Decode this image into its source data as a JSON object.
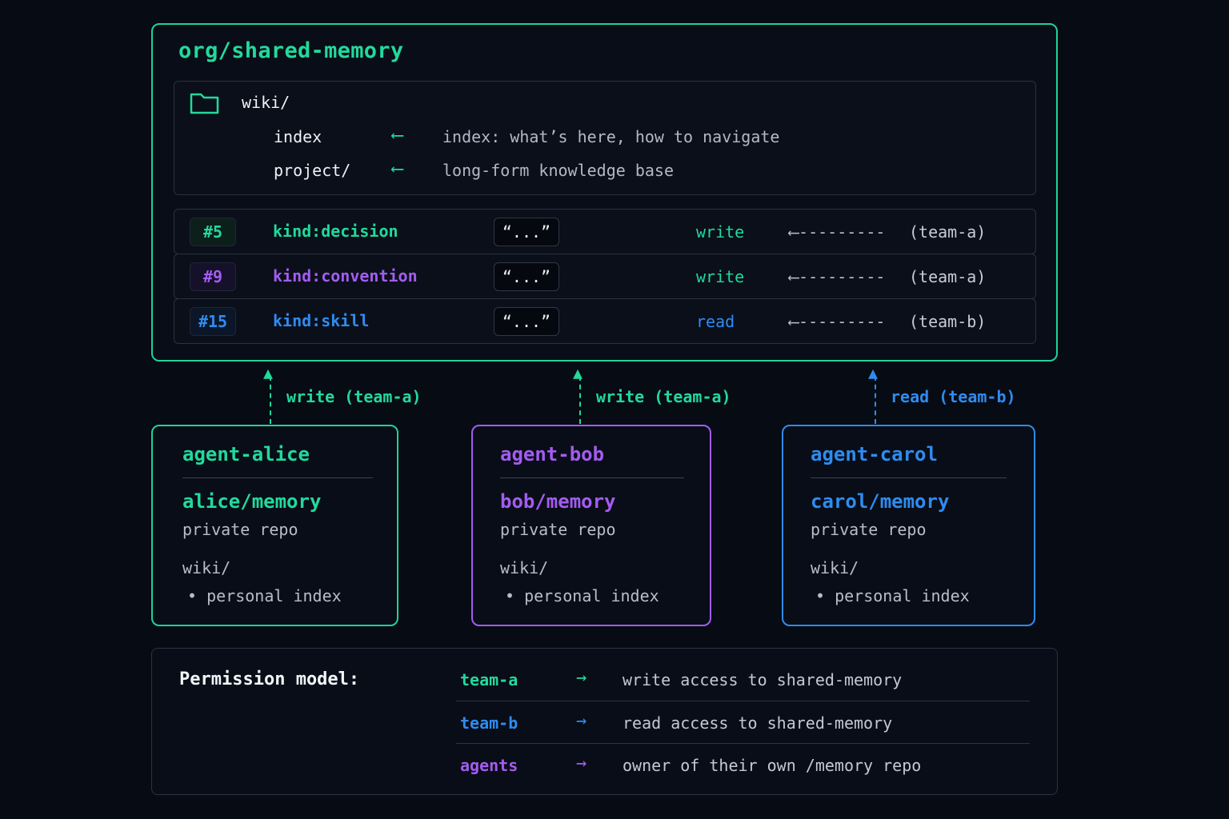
{
  "shared": {
    "title": "org/shared-memory",
    "wiki": {
      "folder": "wiki/",
      "entries": [
        {
          "name": "index",
          "desc": "index: what’s here, how to navigate"
        },
        {
          "name": "project/",
          "desc": "long-form knowledge base"
        }
      ],
      "arrow": "⟵"
    },
    "records": [
      {
        "id": "#5",
        "kind": "kind:decision",
        "value": "“...”",
        "access": "write",
        "arrow": "⟵---------",
        "team": "(team-a)",
        "color": "#22d99c"
      },
      {
        "id": "#9",
        "kind": "kind:convention",
        "value": "“...”",
        "access": "write",
        "arrow": "⟵---------",
        "team": "(team-a)",
        "color": "#a35cf0"
      },
      {
        "id": "#15",
        "kind": "kind:skill",
        "value": "“...”",
        "access": "read",
        "arrow": "⟵---------",
        "team": "(team-b)",
        "color": "#2e8cf0"
      }
    ]
  },
  "connectors": [
    {
      "label": "write (team-a)",
      "color": "#22d99c"
    },
    {
      "label": "write (team-a)",
      "color": "#22d99c"
    },
    {
      "label": "read (team-b)",
      "color": "#2e8cf0"
    }
  ],
  "agents": [
    {
      "name": "agent-alice",
      "repo": "alice/memory",
      "kind": "private repo",
      "folder": "wiki/",
      "item": "• personal index",
      "color": "#22d99c"
    },
    {
      "name": "agent-bob",
      "repo": "bob/memory",
      "kind": "private repo",
      "folder": "wiki/",
      "item": "• personal index",
      "color": "#a35cf0"
    },
    {
      "name": "agent-carol",
      "repo": "carol/memory",
      "kind": "private repo",
      "folder": "wiki/",
      "item": "• personal index",
      "color": "#2e8cf0"
    }
  ],
  "permissions": {
    "title": "Permission model:",
    "arrow": "→",
    "rows": [
      {
        "team": "team-a",
        "desc": "write access to shared-memory",
        "color": "#22d99c"
      },
      {
        "team": "team-b",
        "desc": "read access to shared-memory",
        "color": "#2e8cf0"
      },
      {
        "team": "agents",
        "desc": "owner of their own /memory repo",
        "color": "#a35cf0"
      }
    ]
  },
  "colors": {
    "team_a": "#22d99c",
    "team_b": "#2e8cf0",
    "agents": "#a35cf0",
    "background": "#070b14"
  }
}
